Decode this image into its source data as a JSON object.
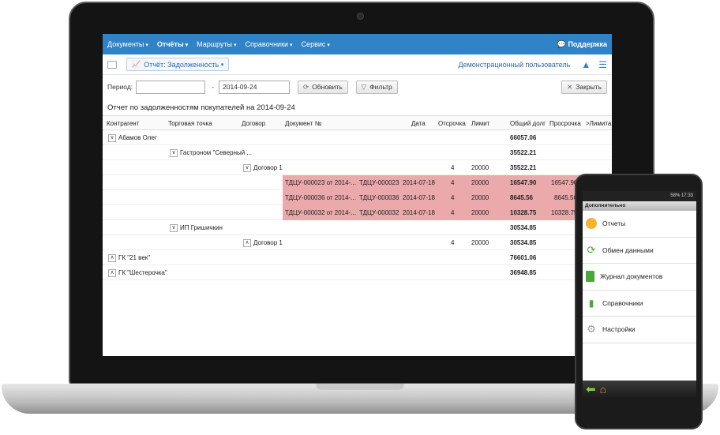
{
  "menu": {
    "items": [
      {
        "label": "Документы",
        "active": false
      },
      {
        "label": "Отчёты",
        "active": true
      },
      {
        "label": "Маршруты",
        "active": false
      },
      {
        "label": "Справочники",
        "active": false
      },
      {
        "label": "Сервис",
        "active": false
      }
    ],
    "support_label": "Поддержка"
  },
  "toolbar": {
    "report_label": "Отчёт: Задолженность",
    "user_label": "Демонстрационный пользователь"
  },
  "filter": {
    "period_label": "Период:",
    "date_from_value": "",
    "dash": "-",
    "date_to_value": "2014-09-24",
    "refresh_label": "Обновить",
    "filter_label": "Фильтр",
    "close_label": "Закрыть"
  },
  "report": {
    "title": "Отчет по задолженностям покупателей на 2014-09-24",
    "columns": [
      "Контрагент",
      "Торговая точка",
      "Договор",
      "Документ №",
      "Дата",
      "Отсрочка",
      "Лимит",
      "Общий долг",
      "Просрочка",
      ">Лимита"
    ],
    "rows": [
      {
        "toggle": "∨",
        "level": 0,
        "label": "Абамов Олег",
        "total": "66057.06"
      },
      {
        "toggle": "∨",
        "level": 1,
        "label": "Гастроном \"Северный ...",
        "total": "35522.21"
      },
      {
        "toggle": "∨",
        "level": 2,
        "label": "Договор 1",
        "delay": "4",
        "limit": "20000",
        "total": "35522.21"
      },
      {
        "highlight": true,
        "doc": "ТДЦУ-000023 от 2014-...",
        "docnum": "ТДЦУ-000023",
        "date": "2014-07-18",
        "delay": "4",
        "limit": "20000",
        "total": "16547.90",
        "overdue": "16547.90"
      },
      {
        "highlight": true,
        "doc": "ТДЦУ-000036 от 2014-...",
        "docnum": "ТДЦУ-000036",
        "date": "2014-07-18",
        "delay": "4",
        "limit": "20000",
        "total": "8645.56",
        "overdue": "8645.56"
      },
      {
        "highlight": true,
        "doc": "ТДЦУ-000032 от 2014-...",
        "docnum": "ТДЦУ-000032",
        "date": "2014-07-18",
        "delay": "4",
        "limit": "20000",
        "total": "10328.75",
        "overdue": "10328.75"
      },
      {
        "toggle": "∨",
        "level": 1,
        "label": "ИП Гришичкин",
        "total": "30534.85"
      },
      {
        "toggle": "∧",
        "level": 2,
        "label": "Договор 1",
        "delay": "4",
        "limit": "20000",
        "total": "30534.85"
      },
      {
        "toggle": "∧",
        "level": 0,
        "label": "ГК \"21 век\"",
        "total": "76601.06"
      },
      {
        "toggle": "∧",
        "level": 0,
        "label": "ГК \"Шестерочка\"",
        "total": "36948.85"
      }
    ]
  },
  "phone": {
    "status": "58% 17:33",
    "title": "Дополнительно",
    "items": [
      {
        "label": "Отчеты",
        "icon": "pie-chart-icon",
        "color": "#f2b530"
      },
      {
        "label": "Обмен данными",
        "icon": "sync-icon",
        "color": "#4aa83a"
      },
      {
        "label": "Журнал документов",
        "icon": "journal-icon",
        "color": "#4aa83a"
      },
      {
        "label": "Справочники",
        "icon": "bookmark-icon",
        "color": "#4aa83a"
      },
      {
        "label": "Настройки",
        "icon": "gear-icon",
        "color": "#9a9a9a"
      }
    ]
  }
}
